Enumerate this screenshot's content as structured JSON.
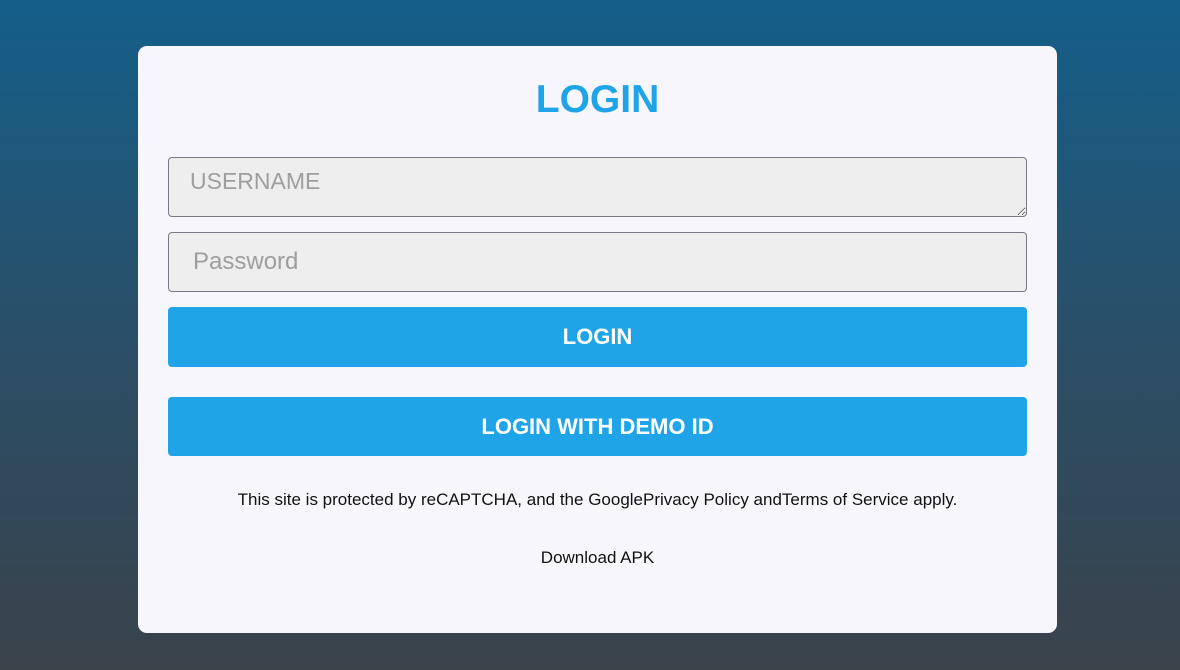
{
  "login_card": {
    "title": "LOGIN",
    "username": {
      "placeholder": "USERNAME",
      "value": ""
    },
    "password": {
      "placeholder": "Password",
      "value": ""
    },
    "login_button": "LOGIN",
    "demo_button": "LOGIN WITH DEMO ID",
    "recaptcha_notice": {
      "prefix": "This site is protected by reCAPTCHA, and the Google",
      "privacy_link": "Privacy Policy",
      "middle": " and",
      "terms_link": "Terms of Service",
      "suffix": " apply."
    },
    "download_link": "Download APK"
  },
  "colors": {
    "accent": "#1fa4e8",
    "card_background": "#f8f6fd",
    "input_background": "#eeeeee",
    "gradient_top": "#145f8a",
    "gradient_bottom": "#3a424a"
  }
}
